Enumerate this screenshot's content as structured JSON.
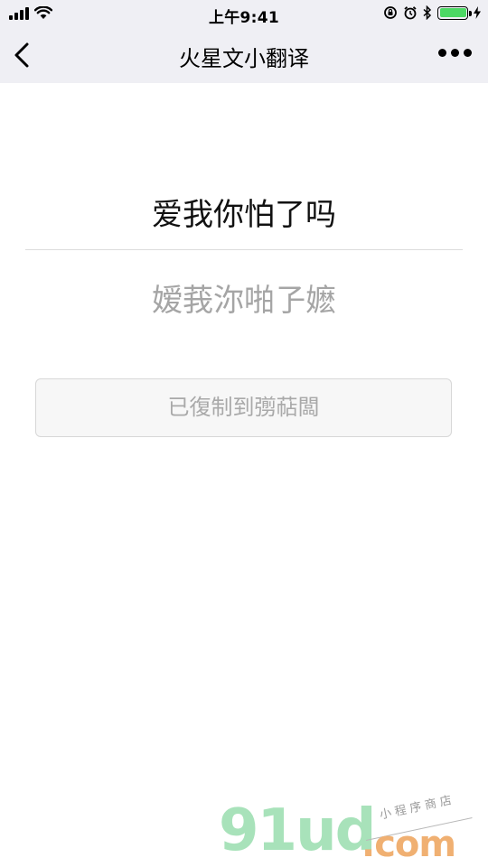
{
  "status_bar": {
    "time": "上午9:41",
    "battery_color": "#4cd964"
  },
  "nav": {
    "title": "火星文小翻译",
    "back_icon": "chevron-left-icon",
    "more_icon": "more-dots-icon"
  },
  "content": {
    "source_text": "爱我你怕了吗",
    "result_text": "嫒莪沵啪孒嬷",
    "copy_button_label": "已復制到彅萜闆"
  },
  "watermark": {
    "logo": "91ud",
    "suffix": ".com",
    "tagline": "小程序商店"
  },
  "colors": {
    "nav_background": "#efeff4",
    "result_text": "#a5a5a5",
    "button_border": "#d7d7d7",
    "watermark_green": "#a8e2ba",
    "watermark_orange": "#f0b072"
  }
}
